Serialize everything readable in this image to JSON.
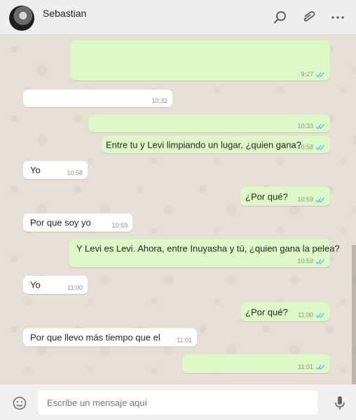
{
  "header": {
    "contact_name": "Sebastian",
    "icons": [
      "avatar",
      "search-icon",
      "paperclip-icon",
      "more-icon"
    ]
  },
  "messages": [
    {
      "dir": "out",
      "text": "",
      "time": "9:27",
      "read": true
    },
    {
      "dir": "in",
      "text": "",
      "time": "10:32"
    },
    {
      "dir": "out",
      "text": "",
      "time": "10:33",
      "read": true
    },
    {
      "dir": "out",
      "text": "Entre tu y Levi limpiando un lugar, ¿quien gana?",
      "time": "10:58",
      "read": true
    },
    {
      "dir": "in",
      "text": "Yo",
      "time": "10:58"
    },
    {
      "dir": "out",
      "text": "¿Por qué?",
      "time": "10:59",
      "read": true
    },
    {
      "dir": "in",
      "text": "Por que soy yo",
      "time": "10:59"
    },
    {
      "dir": "out",
      "text": "Y Levi es Levi. Ahora, entre Inuyasha y tú, ¿quien gana la pelea?",
      "time": "10:59",
      "read": true
    },
    {
      "dir": "in",
      "text": "Yo",
      "time": "11:00"
    },
    {
      "dir": "out",
      "text": "¿Por qué?",
      "time": "11:00",
      "read": true
    },
    {
      "dir": "in",
      "text": "Por que llevo más tiempo que el",
      "time": "11:01"
    },
    {
      "dir": "out",
      "text": "",
      "time": "11:01",
      "read": true
    }
  ],
  "composer": {
    "placeholder": "Escribe un mensaje aquí",
    "emoji_icon": "emoji-icon",
    "mic_icon": "microphone-icon"
  },
  "colors": {
    "outgoing_bubble": "#dcf8c6",
    "incoming_bubble": "#ffffff",
    "chat_background": "#e6dfd6",
    "read_ticks": "#4fc3f7"
  }
}
